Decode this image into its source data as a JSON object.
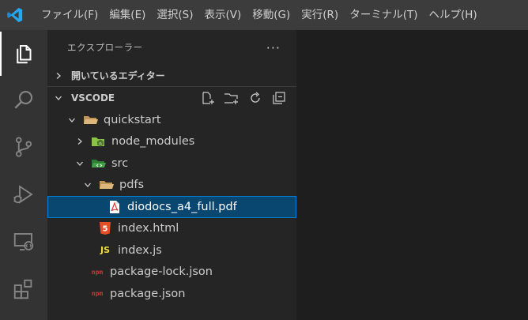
{
  "menu": {
    "items": [
      "ファイル(F)",
      "編集(E)",
      "選択(S)",
      "表示(V)",
      "移動(G)",
      "実行(R)",
      "ターミナル(T)",
      "ヘルプ(H)"
    ]
  },
  "activity_bar": {
    "items": [
      "files-icon",
      "search-icon",
      "source-control-icon",
      "run-debug-icon",
      "remote-explorer-icon",
      "extensions-icon"
    ]
  },
  "sidebar": {
    "title": "エクスプローラー",
    "more": "···",
    "open_editors_label": "開いているエディター",
    "workspace_label": "VSCODE"
  },
  "tree": {
    "quickstart": "quickstart",
    "node_modules": "node_modules",
    "src": "src",
    "pdfs": "pdfs",
    "pdf_file": "diodocs_a4_full.pdf",
    "index_html": "index.html",
    "index_js": "index.js",
    "package_lock": "package-lock.json",
    "package_json": "package.json"
  },
  "icons": {
    "html_badge": "5",
    "js_badge": "JS",
    "npm_badge": "npm"
  },
  "colors": {
    "accent": "#007acc",
    "selection": "#094771",
    "folder": "#c09553",
    "html": "#e44d26",
    "js": "#f1dd3f",
    "npm": "#cb3837",
    "pdf": "#d93831"
  }
}
